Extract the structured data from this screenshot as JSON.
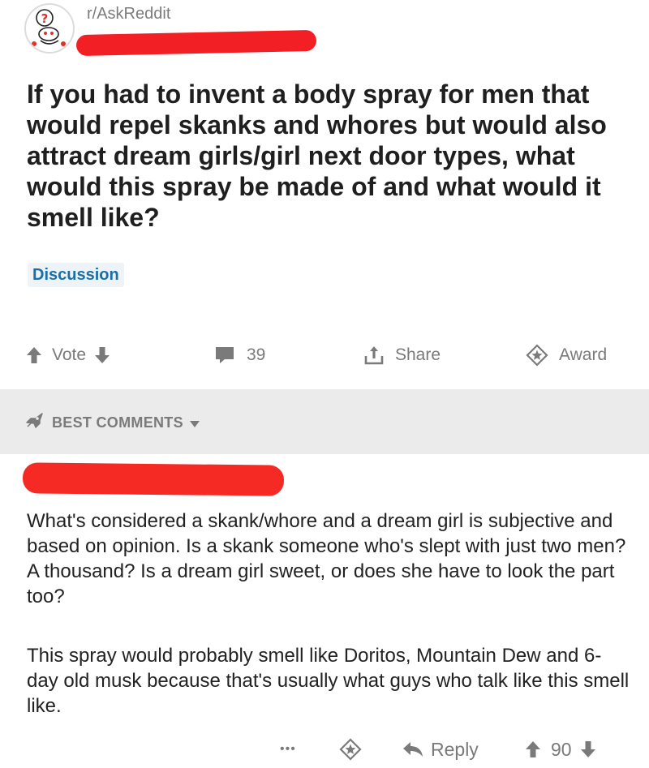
{
  "post": {
    "subreddit": "r/AskReddit",
    "title": "If you had to invent a body spray for men that would repel skanks and whores but would also attract dream girls/girl next door types, what would this spray be made of and what would it smell like?",
    "flair": "Discussion"
  },
  "actions": {
    "vote_label": "Vote",
    "comment_count": "39",
    "share_label": "Share",
    "award_label": "Award"
  },
  "sort": {
    "label": "BEST COMMENTS"
  },
  "comment": {
    "paragraphs": [
      "What's considered a skank/whore and a dream girl is subjective and based on opinion. Is a skank someone who's slept with just two men? A thousand? Is a dream girl sweet, or does she have to look the part too?",
      "This spray would probably smell like Doritos, Mountain Dew and 6-day old musk because that's usually what guys who talk like this smell like."
    ],
    "more_label": "•••",
    "reply_label": "Reply",
    "score": "90"
  },
  "colors": {
    "accent_blue": "#1b6fa8",
    "muted_gray": "#7a7a7a",
    "redaction_red": "#f22024",
    "band_gray": "#ebebeb"
  },
  "icons": [
    "askreddit-avatar-icon",
    "upvote-icon",
    "downvote-icon",
    "comment-icon",
    "share-icon",
    "award-icon",
    "rocket-icon",
    "chevron-down-icon",
    "more-icon",
    "reply-icon"
  ]
}
